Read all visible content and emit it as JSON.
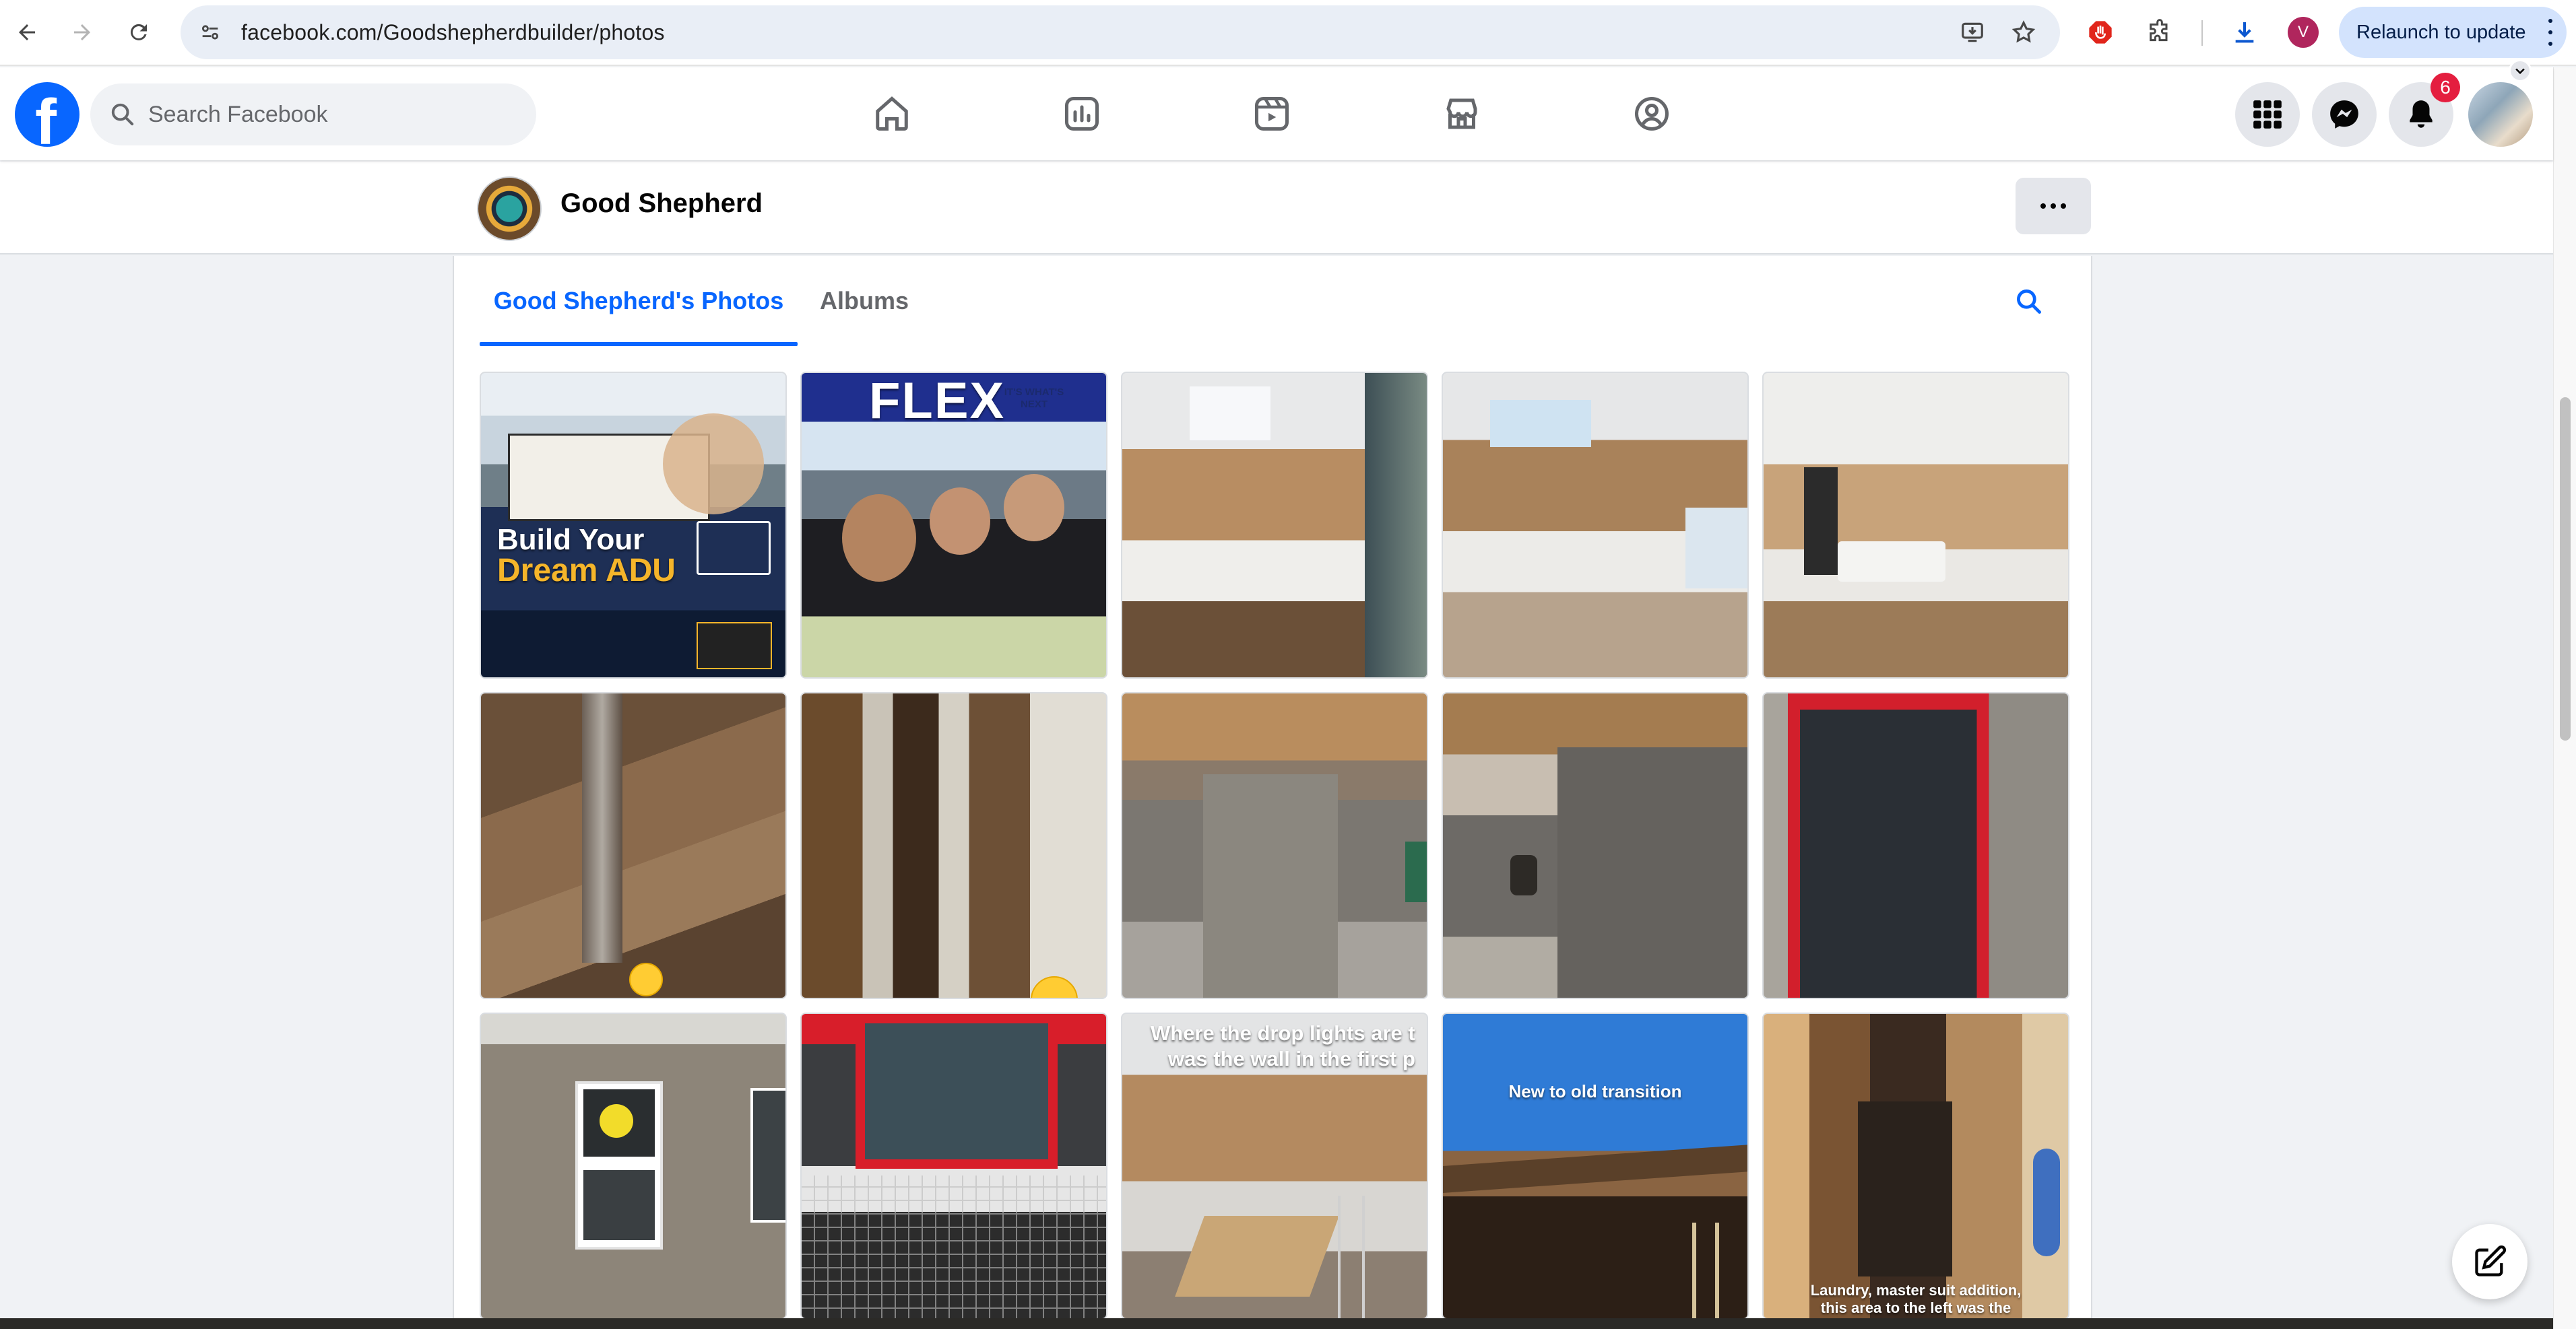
{
  "browser": {
    "url": "facebook.com/Goodshepherdbuilder/photos",
    "profile_initial": "V",
    "relaunch_label": "Relaunch to update"
  },
  "fb": {
    "search_placeholder": "Search Facebook",
    "notification_count": "6",
    "brand_color": "#0866ff",
    "nav_icons": [
      "home-icon",
      "stats-icon",
      "video-icon",
      "marketplace-icon",
      "groups-icon"
    ],
    "right_icons": [
      "menu-grid-icon",
      "messenger-icon",
      "bell-icon",
      "account-avatar"
    ]
  },
  "page": {
    "name": "Good Shepherd"
  },
  "tabs": {
    "photos": "Good Shepherd's Photos",
    "albums": "Albums"
  },
  "photos": [
    {
      "row": 1,
      "col": 1,
      "overlay_lines": [
        "Build Your",
        "Dream ADU"
      ]
    },
    {
      "row": 1,
      "col": 2,
      "overlay_lines": [
        "FLEX",
        "IT'S WHAT'S NEXT"
      ]
    },
    {
      "row": 1,
      "col": 3,
      "overlay_lines": []
    },
    {
      "row": 1,
      "col": 4,
      "overlay_lines": []
    },
    {
      "row": 1,
      "col": 5,
      "overlay_lines": []
    },
    {
      "row": 2,
      "col": 1,
      "overlay_lines": []
    },
    {
      "row": 2,
      "col": 2,
      "overlay_lines": []
    },
    {
      "row": 2,
      "col": 3,
      "overlay_lines": []
    },
    {
      "row": 2,
      "col": 4,
      "overlay_lines": []
    },
    {
      "row": 2,
      "col": 5,
      "overlay_lines": []
    },
    {
      "row": 3,
      "col": 1,
      "overlay_lines": []
    },
    {
      "row": 3,
      "col": 2,
      "overlay_lines": []
    },
    {
      "row": 3,
      "col": 3,
      "overlay_lines": [
        "Where the drop lights are t",
        "was the wall in the first p"
      ]
    },
    {
      "row": 3,
      "col": 4,
      "overlay_lines": [
        "New to old transition"
      ]
    },
    {
      "row": 3,
      "col": 5,
      "overlay_lines": [
        "Laundry, master suit addition,",
        "this area to the left was the"
      ]
    }
  ]
}
